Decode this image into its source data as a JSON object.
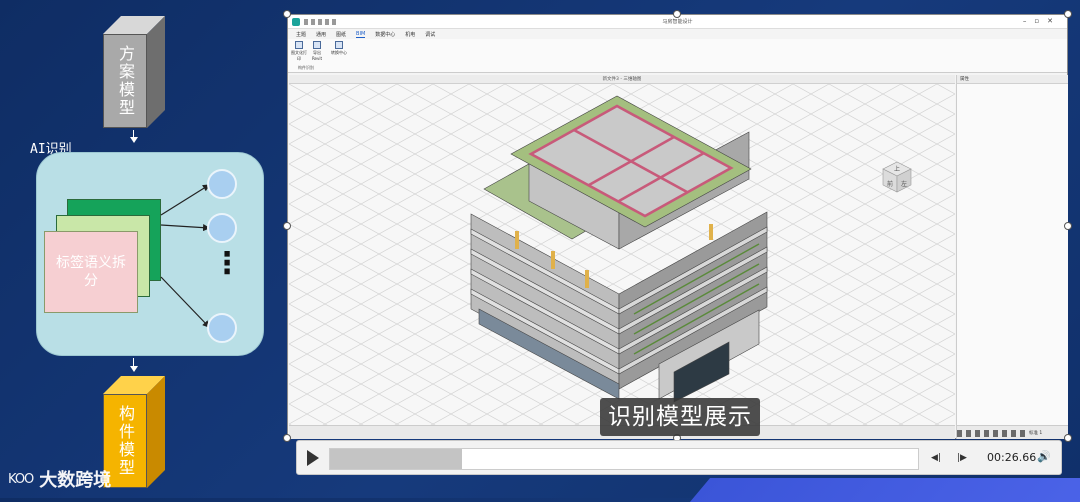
{
  "left_diagram": {
    "top_box_label": "方案模型",
    "ai_label": "AI识别",
    "card_label": "标签语义拆分",
    "dots": "⋮",
    "bottom_box_label": "构件模型"
  },
  "app": {
    "window_title": "马房智能设计",
    "menu": [
      "主题",
      "通用",
      "图纸",
      "BIM",
      "数据中心",
      "机电",
      "调试"
    ],
    "active_menu_index": 3,
    "ribbon_buttons": [
      "图文化打印",
      "导出Revit",
      "转换中心"
    ],
    "ribbon_group_label": "构件识别",
    "viewport_title": "新文件3 - 三维轴图",
    "props_title": "属性",
    "status_scale": "标准 1",
    "viewcube_labels": [
      "上",
      "前",
      "左"
    ]
  },
  "subtitle": "识别模型展示",
  "player": {
    "progress": 0.225,
    "time": "00:26.66",
    "prev_label": "◀|",
    "next_label": "|▶",
    "volume_icon": "🔊"
  },
  "watermark": {
    "mark": "KOO",
    "text": "大数跨境"
  }
}
